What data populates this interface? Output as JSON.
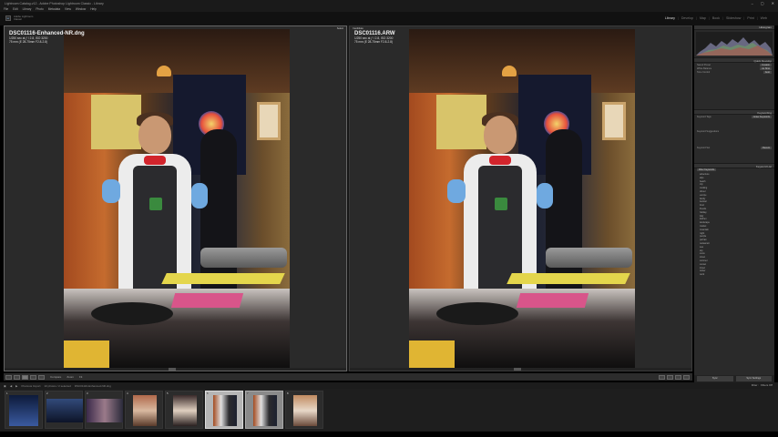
{
  "window": {
    "title": "Lightroom Catalog-v12 - Adobe Photoshop Lightroom Classic - Library",
    "controls": [
      "–",
      "▢",
      "✕"
    ]
  },
  "menu": [
    "File",
    "Edit",
    "Library",
    "Photo",
    "Metadata",
    "View",
    "Window",
    "Help"
  ],
  "identity": {
    "logo": "Lr",
    "line1": "Adobe Lightroom",
    "line2": "Classic"
  },
  "modules": [
    "Library",
    "Develop",
    "Map",
    "Book",
    "Slideshow",
    "Print",
    "Web"
  ],
  "active_module": "Library",
  "compare": {
    "select_tag": "Select",
    "candidate_tag": "Candidate",
    "left": {
      "filename": "DSC01116-Enhanced-NR.dng",
      "exposure": "1/250 sec at ƒ / 2.8, ISO 3200",
      "lens": "75 mm (E 28-75mm F2.8-2.8)"
    },
    "right": {
      "filename": "DSC01116.ARW",
      "exposure": "1/250 sec at ƒ / 2.8, ISO 3200",
      "lens": "75 mm (E 28-75mm F2.8-2.8)"
    }
  },
  "toolbar": {
    "compare_label": "Compare",
    "zoom_label": "Zoom",
    "fit_label": "Fit"
  },
  "right_panel": {
    "histogram_title": "Histogram",
    "quick_develop_title": "Quick Develop",
    "quick_develop": [
      {
        "label": "Saved Preset",
        "value": "Custom"
      },
      {
        "label": "White Balance",
        "value": "As Shot"
      },
      {
        "label": "Tone Control",
        "value": "Auto"
      }
    ],
    "keywording_title": "Keywording",
    "keyword_tags_label": "Keyword Tags",
    "keyword_tags_value": "Enter Keywords",
    "keyword_suggestions": "Keyword Suggestions",
    "keyword_set_label": "Keyword Set",
    "keyword_set_value": "Recent",
    "keyword_list_title": "Keyword List",
    "keyword_list_header": "Filter Keywords",
    "keywords": [
      "adventure",
      "alps",
      "beach",
      "city",
      "cooking",
      "dinner",
      "europe",
      "family",
      "festival",
      "food",
      "friends",
      "holiday",
      "italy",
      "kitchen",
      "landscape",
      "market",
      "mountain",
      "night",
      "people",
      "portrait",
      "restaurant",
      "sea",
      "sky",
      "snow",
      "street",
      "summer",
      "sunset",
      "travel",
      "winter",
      "work"
    ],
    "footer": {
      "sync": "Sync",
      "sync_settings": "Sync Settings"
    }
  },
  "filmstrip_bar": {
    "source": "Previous Import",
    "count": "10 photos / 2 selected",
    "current": "DSC01116-Enhanced-NR.dng",
    "filter_label": "Filter :",
    "filter_value": "Filters Off"
  },
  "filmstrip": {
    "numbers": [
      "1",
      "2",
      "3",
      "4",
      "5",
      "6",
      "7",
      "8"
    ]
  }
}
